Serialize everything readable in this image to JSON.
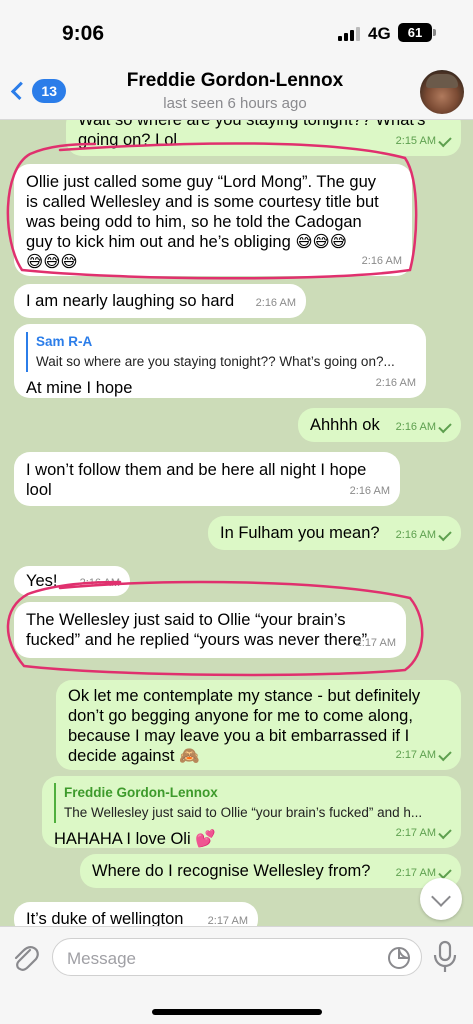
{
  "status_bar": {
    "time": "9:06",
    "network": "4G",
    "battery": "61"
  },
  "header": {
    "back_count": "13",
    "title": "Freddie Gordon-Lennox",
    "subtitle": "last seen 6 hours ago"
  },
  "messages": [
    {
      "dir": "out",
      "text": "Wait so where are you staying tonight?? What's\ngoing on? Lol",
      "time": "2:15 AM",
      "read": true
    },
    {
      "dir": "in",
      "text": "Ollie just called some guy “Lord Mong”. The guy\nis called Wellesley and is some courtesy title but\nwas being odd to him, so he told the Cadogan\nguy to kick him out and he’s obliging 😅😅😅\n😅😅😅",
      "time": "2:16 AM"
    },
    {
      "dir": "in",
      "text": "I am nearly laughing so hard",
      "time": "2:16 AM"
    },
    {
      "dir": "in",
      "reply_name": "Sam R-A",
      "reply_text": "Wait so where are you staying tonight?? What’s going on?...",
      "text": "At mine I hope",
      "time": "2:16 AM"
    },
    {
      "dir": "out",
      "text": "Ahhhh ok",
      "time": "2:16 AM",
      "read": true
    },
    {
      "dir": "in",
      "text": "I won’t follow them and be here all night I hope\nlool",
      "time": "2:16 AM"
    },
    {
      "dir": "out",
      "text": "In Fulham you mean?",
      "time": "2:16 AM",
      "read": true
    },
    {
      "dir": "in",
      "text": "Yes!",
      "time": "2:16 AM"
    },
    {
      "dir": "in",
      "text": "The Wellesley just said to Ollie “your brain’s\nfucked” and he replied “yours was never there”",
      "time": "2:17 AM"
    },
    {
      "dir": "out",
      "text": "Ok let me contemplate my stance - but definitely\ndon’t go begging anyone for me to come along,\nbecause I may leave you a bit embarrassed if I\ndecide against 🙈",
      "time": "2:17 AM",
      "read": true
    },
    {
      "dir": "out",
      "reply_name": "Freddie Gordon-Lennox",
      "reply_text": "The Wellesley just said to Ollie “your brain’s fucked” and h...",
      "text": "HAHAHA I love Oli 💕",
      "time": "2:17 AM",
      "read": true
    },
    {
      "dir": "out",
      "text": "Where do I recognise Wellesley from?",
      "time": "2:17 AM",
      "read": true
    },
    {
      "dir": "in",
      "text": "It’s duke of wellington",
      "time": "2:17 AM"
    }
  ],
  "input": {
    "placeholder": "Message"
  },
  "icons": {
    "back": "chevron-left-icon",
    "attach": "paperclip-icon",
    "sticker": "sticker-icon",
    "mic": "microphone-icon",
    "scroll": "chevron-down-icon"
  },
  "colors": {
    "accent": "#2b7de9",
    "outgoing_bubble": "#dcf8c6",
    "incoming_bubble": "#ffffff",
    "annotation": "#e0306e"
  }
}
